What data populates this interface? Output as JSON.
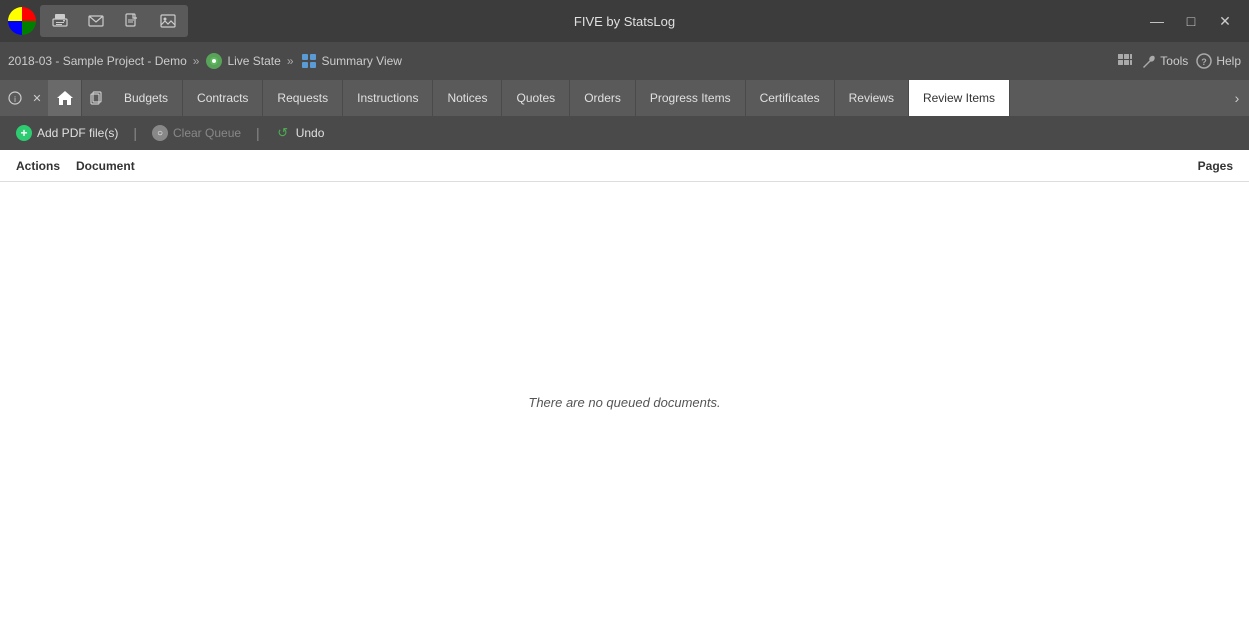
{
  "app": {
    "title": "FIVE by StatsLog"
  },
  "titlebar": {
    "toolbar_btns": [
      "print-icon",
      "email-icon",
      "pdf-icon",
      "image-icon"
    ],
    "minimize_label": "—",
    "maximize_label": "□",
    "close_label": "✕"
  },
  "breadcrumb": {
    "project": "2018-03 - Sample Project - Demo",
    "separator1": "»",
    "live_state_label": "Live State",
    "separator2": "»",
    "summary_view_label": "Summary View"
  },
  "breadcrumb_right": {
    "tools_label": "Tools",
    "help_label": "Help"
  },
  "tabs": [
    {
      "id": "budgets",
      "label": "Budgets",
      "active": false
    },
    {
      "id": "contracts",
      "label": "Contracts",
      "active": false
    },
    {
      "id": "requests",
      "label": "Requests",
      "active": false
    },
    {
      "id": "instructions",
      "label": "Instructions",
      "active": false
    },
    {
      "id": "notices",
      "label": "Notices",
      "active": false
    },
    {
      "id": "quotes",
      "label": "Quotes",
      "active": false
    },
    {
      "id": "orders",
      "label": "Orders",
      "active": false
    },
    {
      "id": "progress-items",
      "label": "Progress Items",
      "active": false
    },
    {
      "id": "certificates",
      "label": "Certificates",
      "active": false
    },
    {
      "id": "reviews",
      "label": "Reviews",
      "active": false
    },
    {
      "id": "review-items",
      "label": "Review Items",
      "active": true
    }
  ],
  "toolbar": {
    "add_pdf_label": "Add PDF file(s)",
    "clear_queue_label": "Clear Queue",
    "undo_label": "Undo",
    "separator": "|"
  },
  "columns": {
    "actions_label": "Actions",
    "document_label": "Document",
    "pages_label": "Pages"
  },
  "main": {
    "empty_message": "There are no queued documents."
  }
}
